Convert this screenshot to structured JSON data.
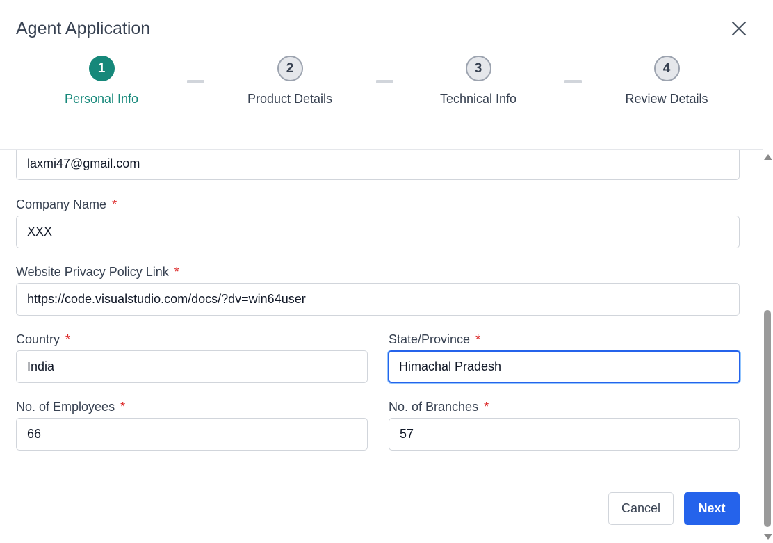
{
  "dialog": {
    "title": "Agent Application",
    "close_icon": "close-icon"
  },
  "stepper": {
    "steps": [
      {
        "number": "1",
        "label": "Personal Info",
        "state": "active"
      },
      {
        "number": "2",
        "label": "Product Details",
        "state": "inactive"
      },
      {
        "number": "3",
        "label": "Technical Info",
        "state": "inactive"
      },
      {
        "number": "4",
        "label": "Review Details",
        "state": "inactive"
      }
    ],
    "active_color": "#16887a"
  },
  "form": {
    "email": {
      "value": "laxmi47@gmail.com"
    },
    "company_name": {
      "label": "Company Name",
      "required": "*",
      "value": "XXX"
    },
    "privacy_link": {
      "label": "Website Privacy Policy Link",
      "required": "*",
      "value": "https://code.visualstudio.com/docs/?dv=win64user"
    },
    "country": {
      "label": "Country",
      "required": "*",
      "value": "India"
    },
    "state": {
      "label": "State/Province",
      "required": "*",
      "value": "Himachal Pradesh"
    },
    "employees": {
      "label": "No. of Employees",
      "required": "*",
      "value": "66"
    },
    "branches": {
      "label": "No. of Branches",
      "required": "*",
      "value": "57"
    }
  },
  "actions": {
    "cancel_label": "Cancel",
    "next_label": "Next"
  },
  "colors": {
    "primary": "#2563eb",
    "required": "#dc2626"
  }
}
